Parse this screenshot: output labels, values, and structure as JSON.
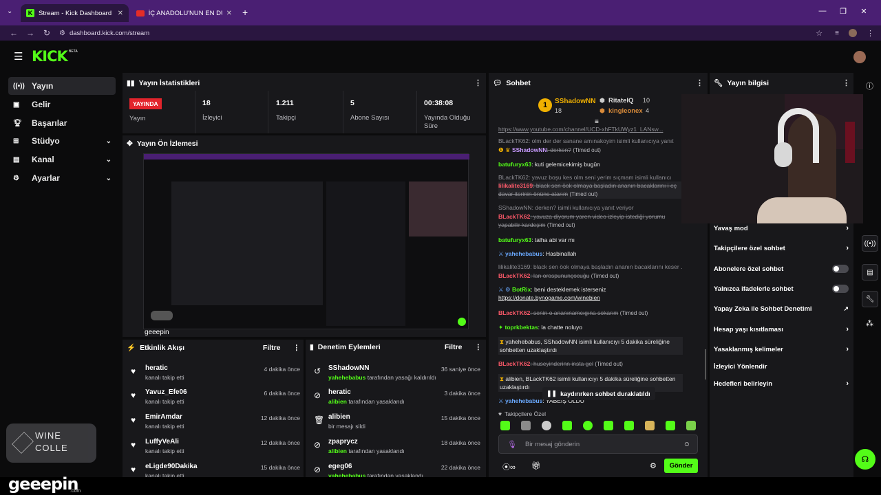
{
  "browser": {
    "tabs": [
      {
        "title": "Stream - Kick Dashboard"
      },
      {
        "title": "İÇ ANADOLU'NUN EN DÜŞÜK"
      }
    ],
    "url": "dashboard.kick.com/stream"
  },
  "header": {
    "logo": "KICK",
    "logo_sup": "BETA"
  },
  "sidebar": {
    "items": [
      {
        "label": "Yayın",
        "icon": "broadcast-icon"
      },
      {
        "label": "Gelir",
        "icon": "money-icon"
      },
      {
        "label": "Başarılar",
        "icon": "trophy-icon"
      },
      {
        "label": "Stüdyo",
        "icon": "studio-icon"
      },
      {
        "label": "Kanal",
        "icon": "channel-icon"
      },
      {
        "label": "Ayarlar",
        "icon": "gear-icon"
      }
    ]
  },
  "stats": {
    "title": "Yayın İstatistikleri",
    "live_badge": "YAYINDA",
    "items": [
      {
        "value": "",
        "label": "Yayın"
      },
      {
        "value": "18",
        "label": "İzleyici"
      },
      {
        "value": "1.211",
        "label": "Takipçi"
      },
      {
        "value": "5",
        "label": "Abone Sayısı"
      },
      {
        "value": "00:38:08",
        "label": "Yayında Olduğu Süre"
      }
    ]
  },
  "preview": {
    "title": "Yayın Ön İzlemesi",
    "watermark": "geeepin"
  },
  "activity": {
    "title": "Etkinlik Akışı",
    "filter": "Filtre",
    "items": [
      {
        "name": "heratic",
        "sub": "kanalı takip etti",
        "time": "4 dakika önce"
      },
      {
        "name": "Yavuz_Efe06",
        "sub": "kanalı takip etti",
        "time": "6 dakika önce"
      },
      {
        "name": "EmirAmdar",
        "sub": "kanalı takip etti",
        "time": "12 dakika önce"
      },
      {
        "name": "LuffyVeAli",
        "sub": "kanalı takip etti",
        "time": "12 dakika önce"
      },
      {
        "name": "eLigde90Dakika",
        "sub": "kanalı takip etti",
        "time": "15 dakika önce"
      }
    ]
  },
  "moderation": {
    "title": "Denetim Eylemleri",
    "filter": "Filtre",
    "items": [
      {
        "name": "SShadowNN",
        "actor": "yahehebabus",
        "sub": "tarafından yasağı kaldırıldı",
        "time": "36 saniye önce"
      },
      {
        "name": "heratic",
        "actor": "alibien",
        "sub": "tarafından yasaklandı",
        "time": "3 dakika önce"
      },
      {
        "name": "alibien",
        "actor": "",
        "sub": "bir mesajı sildi",
        "time": "15 dakika önce"
      },
      {
        "name": "zpaprycz",
        "actor": "alibien",
        "sub": "tarafından yasaklandı",
        "time": "18 dakika önce"
      },
      {
        "name": "egeg06",
        "actor": "yahehebabus",
        "sub": "tarafından yasaklandı",
        "time": "22 dakika önce"
      }
    ]
  },
  "chat": {
    "title": "Sohbet",
    "top": [
      {
        "name": "SShadowNN",
        "count": "18"
      },
      {
        "name": "RitateIQ",
        "count": "10"
      },
      {
        "name": "kingleonex",
        "count": "4"
      }
    ],
    "messages": {
      "m0": "https://www.youtube.com/channel/UCD-xhFTkUWyz1_LANsw...",
      "m1": "BLackTK62: olm der der sanane amınakoyim isimli kullanıcıya yanıt",
      "m2a": "SShadowNN",
      "m2b": ": derken?",
      "m2c": "(Timed out)",
      "m3a": "batufuryx63",
      "m3b": ": kuti gelemicekimiş bugün",
      "m4": "BLackTK62: yavuz boşu kes olm seni yerim sıçmam isimli kullanıcı",
      "m5a": "lilikalite3169",
      "m5b": ": black sen öok olmaya başladın ananın bacaklarını i eç davar iterinin önüne atarım",
      "m5c": "(Timed out)",
      "m6": "SShadowNN: derken? isimli kullanıcıya yanıt veriyor",
      "m7a": "BLackTK62",
      "m7b": ": yavuza diyorum yaren video izleyip istediği yorumu yapabilir kardeşim",
      "m7c": "(Timed out)",
      "m8a": "batufuryx63",
      "m8b": ": talha abi var mı",
      "m9a": "yahehebabus",
      "m9b": ": Hasbinallah",
      "m10": "lilikalite3169: black sen öok olmaya başladın ananın bacaklarını keser ...",
      "m11a": "BLackTK62",
      "m11b": ": lan orospununçocuğu",
      "m11c": "(Timed out)",
      "m12a": "BotRix",
      "m12b": ": beni desteklemek isterseniz",
      "m12c": "https://donate.bynogame.com/winebien",
      "m13a": "BLackTK62",
      "m13b": ": senin o ananınamcıgına sokarım",
      "m13c": "(Timed out)",
      "m14a": "toprkbektas",
      "m14b": ": la chatte noluyo",
      "m15": "yahehebabus, SShadowNN isimli kullanıcıyı 5 dakika süreliğine sohbetten uzaklaştırdı",
      "m16a": "BLackTK62",
      "m16b": ": huseyinderinn insta gel",
      "m16c": "(Timed out)",
      "m17": "alibien, BLackTK62 isimli kullanıcıyı 5 dakika süreliğine sohbetten uzaklaştırdı",
      "m18a": "yahehebabus",
      "m18b": ": YABEİŞ OLDU"
    },
    "paused": "kaydırırken sohbet duraklatıldı",
    "followers_only": "Takipçilere Özel",
    "placeholder": "Bir mesaj gönderin",
    "send": "Gönder"
  },
  "stream_info": {
    "title": "Yayın bilgisi",
    "items": [
      {
        "label": "Yavaş mod",
        "type": "chevron"
      },
      {
        "label": "Takipçilere özel sohbet",
        "type": "chevron"
      },
      {
        "label": "Abonelere özel sohbet",
        "type": "toggle"
      },
      {
        "label": "Yalnızca ifadelerle sohbet",
        "type": "toggle"
      },
      {
        "label": "Yapay Zeka ile Sohbet Denetimi",
        "type": "external"
      },
      {
        "label": "Hesap yaşı kısıtlaması",
        "type": "chevron"
      },
      {
        "label": "Yasaklanmış kelimeler",
        "type": "chevron"
      },
      {
        "label": "İzleyici Yönlendir",
        "type": "none"
      },
      {
        "label": "Hedefleri belirleyin",
        "type": "chevron"
      }
    ]
  },
  "overlays": {
    "brand": "geeepin",
    "brand_sub": ".com",
    "wine_line1": "WINE",
    "wine_line2": "COLLE"
  },
  "colors": {
    "accent": "#53fc18",
    "live": "#e2242c",
    "browser": "#4a1f73"
  }
}
